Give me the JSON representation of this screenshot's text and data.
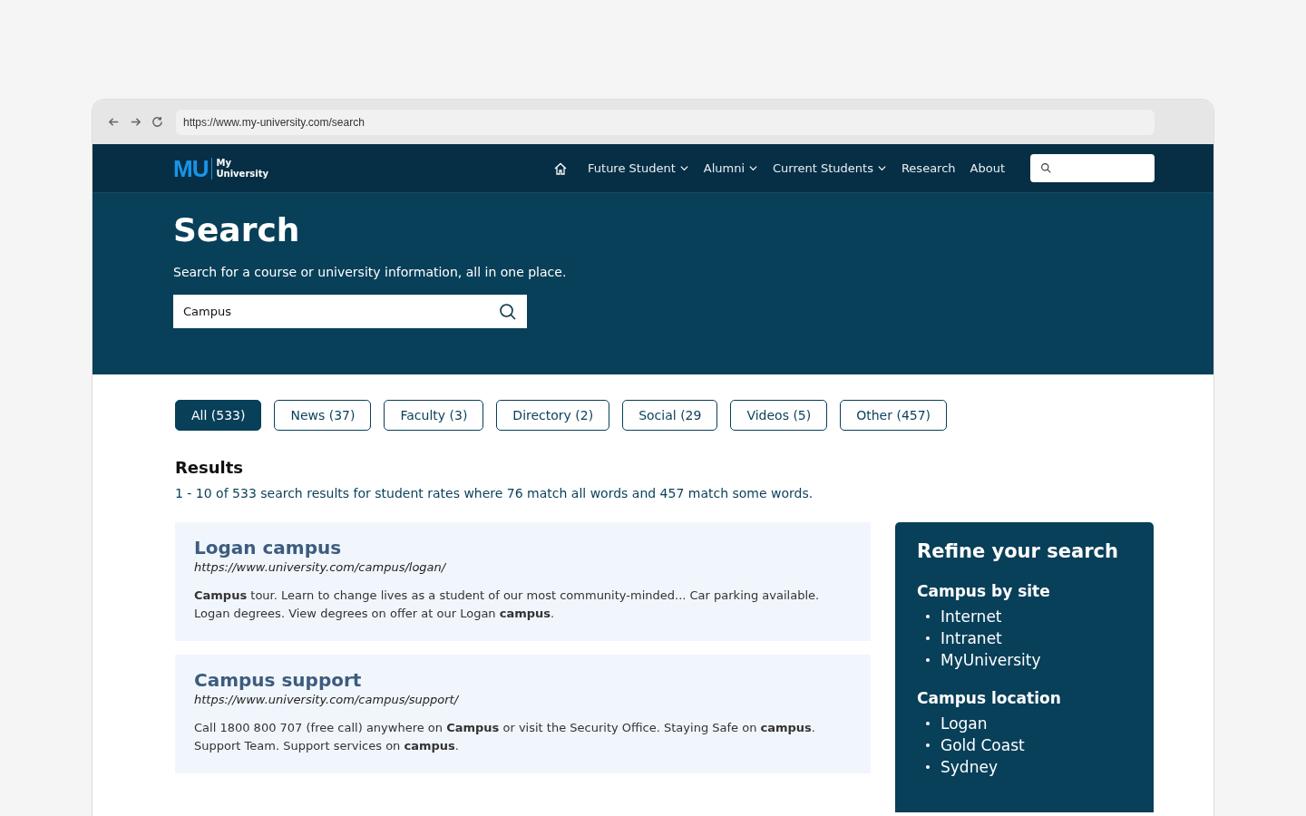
{
  "browser": {
    "url": "https://www.my-university.com/search"
  },
  "header": {
    "logo_mark": "MU",
    "logo_text_top": "My",
    "logo_text_bottom": "University",
    "nav": [
      {
        "label": "Future Student",
        "dropdown": true
      },
      {
        "label": "Alumni",
        "dropdown": true
      },
      {
        "label": "Current Students",
        "dropdown": true
      },
      {
        "label": "Research",
        "dropdown": false
      },
      {
        "label": "About",
        "dropdown": false
      }
    ]
  },
  "hero": {
    "title": "Search",
    "subtitle": "Search for a course or university information, all in one place.",
    "search_value": "Campus"
  },
  "tabs": [
    {
      "label": "All (533)",
      "selected": true
    },
    {
      "label": "News (37)",
      "selected": false
    },
    {
      "label": "Faculty (3)",
      "selected": false
    },
    {
      "label": "Directory (2)",
      "selected": false
    },
    {
      "label": "Social (29",
      "selected": false
    },
    {
      "label": "Videos (5)",
      "selected": false
    },
    {
      "label": "Other (457)",
      "selected": false
    }
  ],
  "results": {
    "heading": "Results",
    "summary": "1 - 10 of 533 search results for student rates where 76 match all words and 457 match some words.",
    "items": [
      {
        "title": "Logan campus",
        "url": "https://www.university.com/campus/logan/",
        "snippet": "**Campus** tour. Learn to change lives as a student of our most community-minded... Car parking available. Logan degrees. View degrees on offer at our Logan **campus**."
      },
      {
        "title": "Campus support",
        "url": "https://www.university.com/campus/support/",
        "snippet": "Call 1800 800 707 (free call) anywhere on **Campus** or visit the Security Office. Staying Safe on **campus**.  Support Team. Support services on **campus**."
      }
    ]
  },
  "refine": {
    "title": "Refine your search",
    "groups": [
      {
        "heading": "Campus by site",
        "items": [
          "Internet",
          "Intranet",
          "MyUniversity"
        ]
      },
      {
        "heading": "Campus  location",
        "items": [
          "Logan",
          "Gold Coast",
          "Sydney"
        ]
      }
    ]
  }
}
